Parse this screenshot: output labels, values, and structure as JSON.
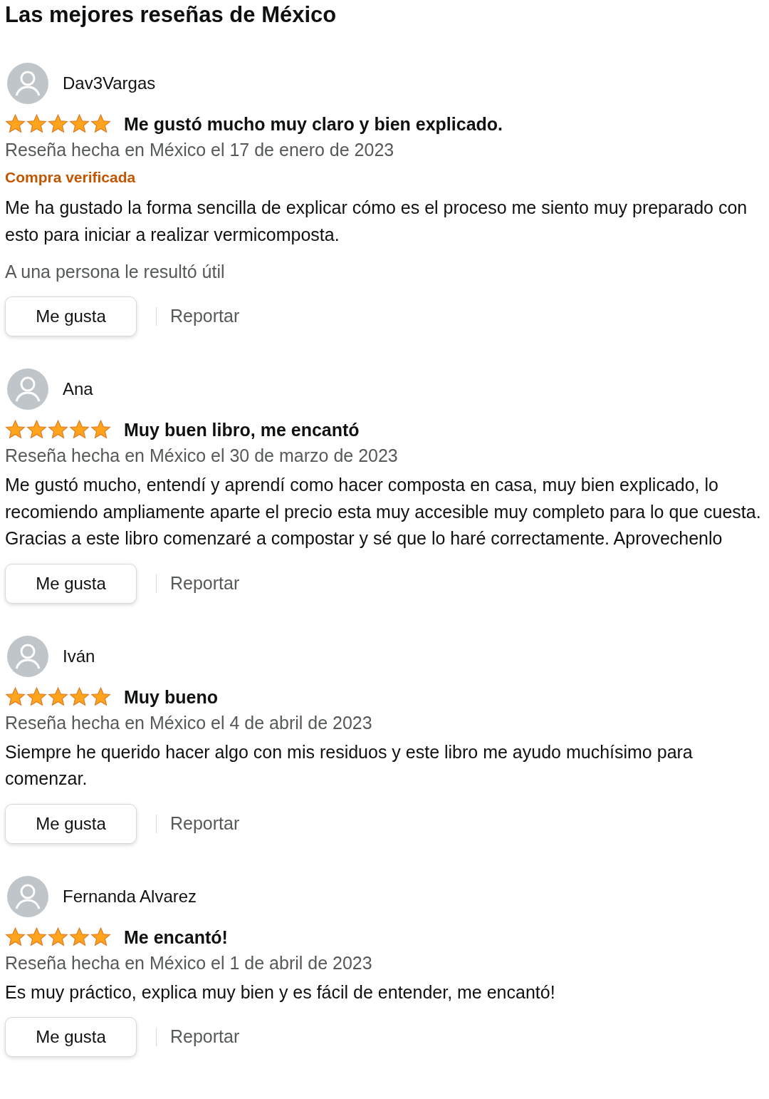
{
  "title": "Las mejores reseñas de México",
  "reviews": [
    {
      "author": "Dav3Vargas",
      "stars": 5,
      "headline": "Me gustó mucho muy claro y bien explicado.",
      "date": "Reseña hecha en México el 17 de enero de 2023",
      "badge": "Compra verificada",
      "body": "Me ha gustado la forma sencilla de explicar cómo es el proceso me siento muy preparado con esto para iniciar a realizar vermicomposta.",
      "helpful": "A una persona le resultó útil",
      "like": "Me gusta",
      "report": "Reportar"
    },
    {
      "author": "Ana",
      "stars": 5,
      "headline": "Muy buen libro, me encantó",
      "date": "Reseña hecha en México el 30 de marzo de 2023",
      "body": "Me gustó mucho, entendí y aprendí como hacer composta en casa, muy bien explicado, lo recomiendo ampliamente aparte el precio esta muy accesible muy completo para lo que cuesta. Gracias a este libro comenzaré a compostar y sé que lo haré correctamente. Aprovechenlo",
      "like": "Me gusta",
      "report": "Reportar"
    },
    {
      "author": "Iván",
      "stars": 5,
      "headline": "Muy bueno",
      "date": "Reseña hecha en México el 4 de abril de 2023",
      "body": "Siempre he querido hacer algo con mis residuos y este libro me ayudo muchísimo para comenzar.",
      "like": "Me gusta",
      "report": "Reportar"
    },
    {
      "author": "Fernanda Alvarez",
      "stars": 5,
      "headline": "Me encantó!",
      "date": "Reseña hecha en México el 1 de abril de 2023",
      "body": "Es muy práctico, explica muy bien y es fácil de entender, me encantó!",
      "like": "Me gusta",
      "report": "Reportar"
    }
  ]
}
